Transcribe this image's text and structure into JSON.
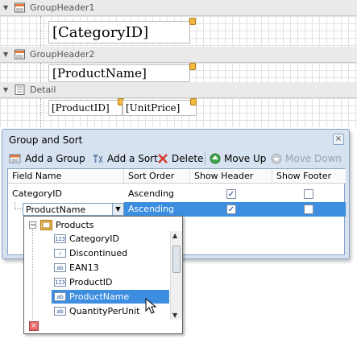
{
  "designer": {
    "bands": [
      {
        "name": "GroupHeader1",
        "field": "[CategoryID]"
      },
      {
        "name": "GroupHeader2",
        "field": "[ProductName]"
      },
      {
        "name": "Detail",
        "fields": [
          "[ProductID]",
          "[UnitPrice]"
        ]
      }
    ]
  },
  "dialog": {
    "title": "Group and Sort",
    "close": "×",
    "toolbar": {
      "add_group": "Add a Group",
      "add_sort": "Add a Sort",
      "delete": "Delete",
      "move_up": "Move Up",
      "move_down": "Move Down"
    },
    "columns": [
      "Field Name",
      "Sort Order",
      "Show Header",
      "Show Footer"
    ],
    "rows": [
      {
        "field": "CategoryID",
        "order": "Ascending",
        "show_header": true,
        "show_footer": false
      },
      {
        "field": "ProductName",
        "order": "Ascending",
        "show_header": true,
        "show_footer": false
      }
    ]
  },
  "dropdown": {
    "root": "Products",
    "items": [
      {
        "label": "CategoryID",
        "icon": "123"
      },
      {
        "label": "Discontinued",
        "icon": "check"
      },
      {
        "label": "EAN13",
        "icon": "ab"
      },
      {
        "label": "ProductID",
        "icon": "123"
      },
      {
        "label": "ProductName",
        "icon": "ab",
        "selected": true
      },
      {
        "label": "QuantityPerUnit",
        "icon": "ab"
      }
    ]
  },
  "colors": {
    "selection": "#3d8ee0",
    "dialog_bg": "#d7e2f0",
    "tag": "#f4b940"
  }
}
